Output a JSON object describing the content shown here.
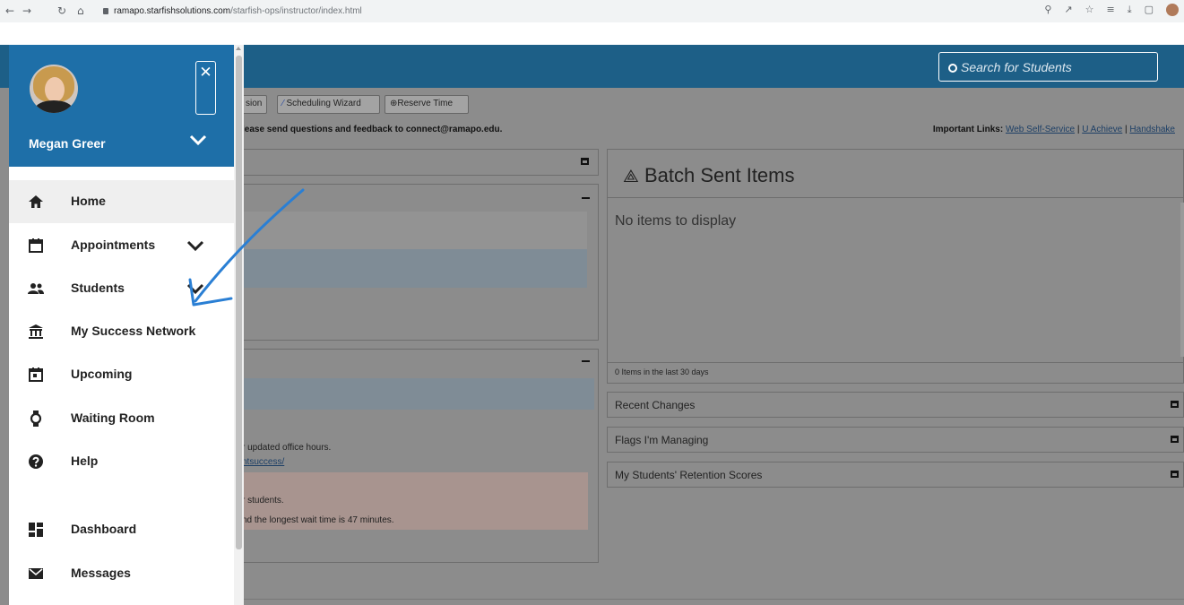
{
  "browser": {
    "nav_icons": [
      "←",
      "→",
      "↻",
      "⌂"
    ],
    "url_host": "ramapo.starfishsolutions.com",
    "url_path": "/starfish-ops/instructor/index.html",
    "right_icons": [
      "⚲",
      "↗",
      "☆",
      "≡",
      "⤓",
      "▢"
    ]
  },
  "header": {
    "search_placeholder": "Search for Students"
  },
  "toolbar": {
    "buttons": [
      "sion",
      "Scheduling Wizard",
      "Reserve Time"
    ],
    "notice": "lease send questions and feedback to connect@ramapo.edu.",
    "important_label": "Important Links:",
    "links": [
      "Web Self-Service",
      "U Achieve",
      "Handshake"
    ],
    "sep": " | "
  },
  "panels": {
    "office_hours_text": "r updated office hours.",
    "office_link": "ntsuccess/",
    "wait_students": "r students.",
    "wait_time": "nd the longest wait time is 47 minutes."
  },
  "batch": {
    "title": "Batch Sent Items",
    "empty": "No items to display",
    "footer": "0 Items in the last 30 days"
  },
  "right_panels": [
    "Recent Changes",
    "Flags I'm Managing",
    "My Students' Retention Scores"
  ],
  "sidebar": {
    "user_name": "Megan Greer",
    "close_glyph": "✕",
    "items": [
      {
        "label": "Home",
        "icon": "home-icon"
      },
      {
        "label": "Appointments",
        "icon": "calendar-icon",
        "expandable": true
      },
      {
        "label": "Students",
        "icon": "people-icon",
        "expandable": true
      },
      {
        "label": "My Success Network",
        "icon": "bank-icon"
      },
      {
        "label": "Upcoming",
        "icon": "calendar-event-icon"
      },
      {
        "label": "Waiting Room",
        "icon": "watch-icon"
      },
      {
        "label": "Help",
        "icon": "help-icon"
      },
      {
        "label": "Dashboard",
        "icon": "dashboard-icon"
      },
      {
        "label": "Messages",
        "icon": "mail-icon"
      }
    ]
  },
  "colors": {
    "topbar": "#1d5f87",
    "sidebar_header": "#1e6fa8",
    "overlay": "#8c8c8c",
    "annotation": "#2a7fd4"
  }
}
